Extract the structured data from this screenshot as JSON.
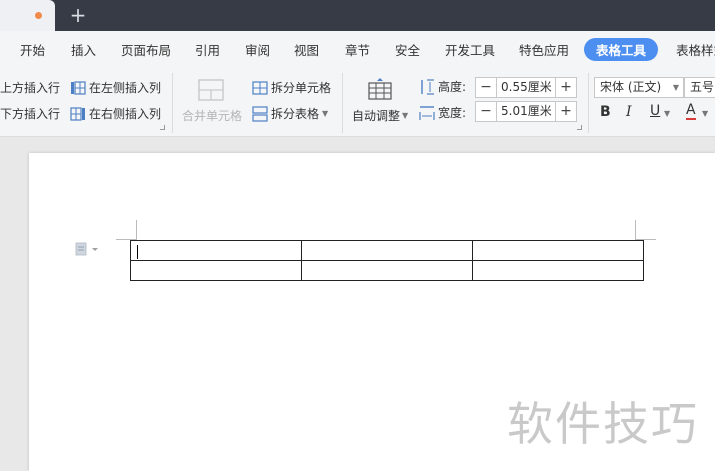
{
  "menu": {
    "items": [
      "开始",
      "插入",
      "页面布局",
      "引用",
      "审阅",
      "视图",
      "章节",
      "安全",
      "开发工具",
      "特色应用"
    ],
    "active": "表格工具",
    "next": "表格样式"
  },
  "toolbar": {
    "insert_above": "上方插入行",
    "insert_below": "下方插入行",
    "insert_left": "在左侧插入列",
    "insert_right": "在右侧插入列",
    "merge_cells": "合并单元格",
    "split_cells": "拆分单元格",
    "split_table": "拆分表格",
    "auto_fit": "自动调整",
    "height_label": "高度:",
    "height_value": "0.55厘米",
    "width_label": "宽度:",
    "width_value": "5.01厘米",
    "font_name": "宋体 (正文)",
    "font_size": "五号"
  },
  "watermark": "软件技巧"
}
